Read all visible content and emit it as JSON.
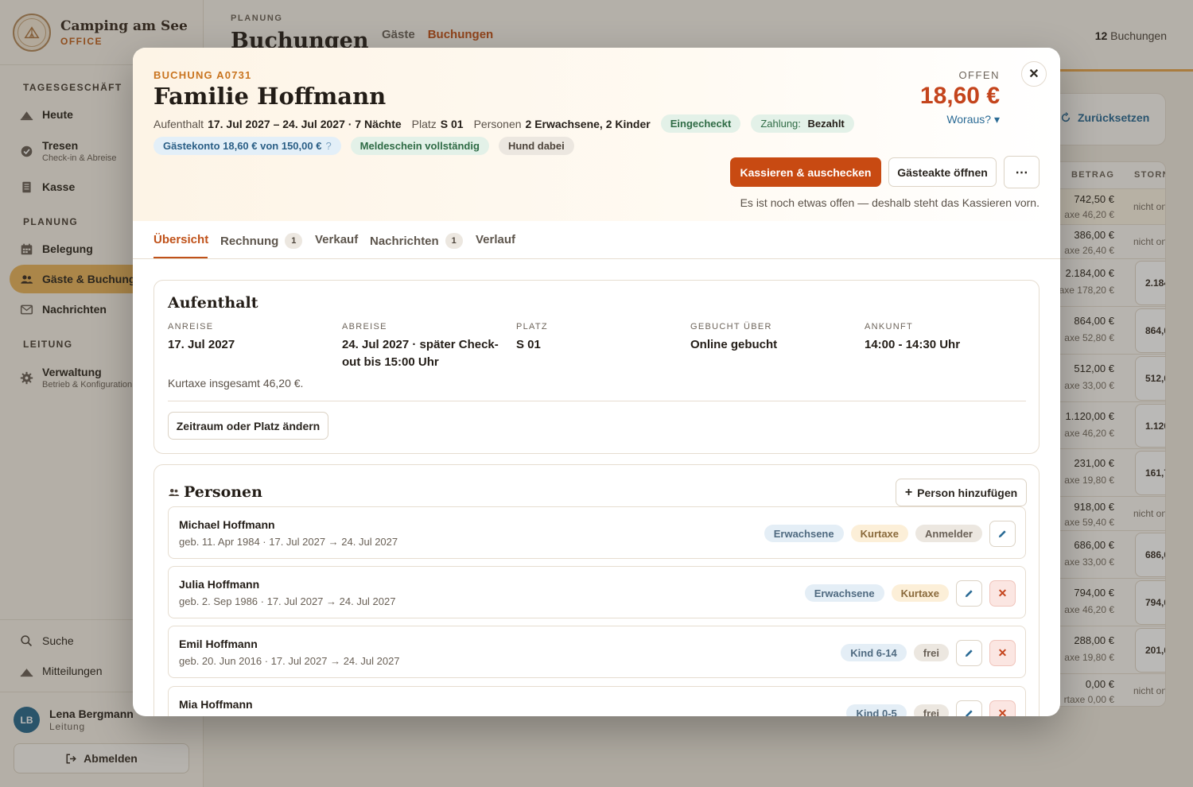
{
  "brand": {
    "name": "Camping am See",
    "sub": "OFFICE"
  },
  "nav": {
    "sections": [
      "TAGESGESCHÄFT",
      "PLANUNG",
      "LEITUNG"
    ],
    "items": [
      {
        "label": "Heute",
        "icon": "tent-icon"
      },
      {
        "label": "Tresen",
        "sub": "Check-in & Abreise",
        "icon": "check-circle-icon"
      },
      {
        "label": "Kasse",
        "icon": "receipt-icon"
      },
      {
        "label": "Belegung",
        "icon": "calendar-icon"
      },
      {
        "label": "Gäste & Buchungen",
        "icon": "users-icon",
        "active": true
      },
      {
        "label": "Nachrichten",
        "icon": "mail-icon"
      },
      {
        "label": "Verwaltung",
        "sub": "Betrieb & Konfiguration",
        "icon": "gear-icon"
      }
    ],
    "search": "Suche",
    "notifications": "Mitteilungen"
  },
  "user": {
    "initials": "LB",
    "name": "Lena Bergmann",
    "role": "Leitung",
    "logout": "Abmelden"
  },
  "header": {
    "eyebrow": "PLANUNG",
    "title": "Buchungen",
    "tabs": [
      "Gäste",
      "Buchungen"
    ],
    "count_value": "12",
    "count_label": "Buchungen"
  },
  "table": {
    "reset": "Zurücksetzen",
    "headers": [
      "BETRAG",
      "STORNO"
    ],
    "rows": [
      {
        "amount": "742,50 €",
        "tax": "axe 46,20 €",
        "storno": "nicht on"
      },
      {
        "amount": "386,00 €",
        "tax": "axe 26,40 €",
        "storno": "nicht on"
      },
      {
        "amount": "2.184,00 €",
        "tax": "axe 178,20 €",
        "storno_box": "2.184"
      },
      {
        "amount": "864,00 €",
        "tax": "axe 52,80 €",
        "storno_box": "864,0"
      },
      {
        "amount": "512,00 €",
        "tax": "axe 33,00 €",
        "storno_box": "512,0"
      },
      {
        "amount": "1.120,00 €",
        "tax": "axe 46,20 €",
        "storno_box": "1.120"
      },
      {
        "amount": "231,00 €",
        "tax": "axe 19,80 €",
        "storno_box": "161,7"
      },
      {
        "amount": "918,00 €",
        "tax": "axe 59,40 €",
        "storno": "nicht on"
      },
      {
        "amount": "686,00 €",
        "tax": "axe 33,00 €",
        "storno_box": "686,0"
      },
      {
        "amount": "794,00 €",
        "tax": "axe 46,20 €",
        "storno_box": "794,0"
      },
      {
        "amount": "288,00 €",
        "tax": "axe 19,80 €",
        "storno_box": "201,6"
      },
      {
        "amount": "0,00 €",
        "tax": "rtaxe 0,00 €",
        "storno": "nicht on"
      }
    ]
  },
  "modal": {
    "eyebrow": "BUCHUNG A0731",
    "title": "Familie Hoffmann",
    "meta": {
      "stay_label": "Aufenthalt",
      "stay_value": "17. Jul 2027 – 24. Jul 2027 · 7 Nächte",
      "pitch_label": "Platz",
      "pitch_value": "S 01",
      "persons_label": "Personen",
      "persons_value": "2 Erwachsene, 2 Kinder"
    },
    "pills": {
      "checked_in": "Eingecheckt",
      "payment_label": "Zahlung:",
      "payment_value": "Bezahlt",
      "account": "Gästekonto 18,60 € von 150,00 €",
      "account_help": "?",
      "registration": "Meldeschein vollständig",
      "dog": "Hund dabei"
    },
    "status": {
      "label": "OFFEN",
      "amount": "18,60 €",
      "link": "Woraus? ▾"
    },
    "close": "✕",
    "actions": {
      "primary": "Kassieren & auschecken",
      "secondary": "Gästeakte öffnen",
      "more": "⋯"
    },
    "hint": "Es ist noch etwas offen — deshalb steht das Kassieren vorn.",
    "tabs": [
      {
        "label": "Übersicht"
      },
      {
        "label": "Rechnung",
        "badge": "1"
      },
      {
        "label": "Verkauf"
      },
      {
        "label": "Nachrichten",
        "badge": "1"
      },
      {
        "label": "Verlauf"
      }
    ],
    "stay": {
      "title": "Aufenthalt",
      "fields": [
        {
          "label": "ANREISE",
          "value": "17. Jul 2027"
        },
        {
          "label": "ABREISE",
          "value": "24. Jul 2027 · später Check-out bis 15:00 Uhr"
        },
        {
          "label": "PLATZ",
          "value": "S 01"
        },
        {
          "label": "GEBUCHT ÜBER",
          "value": "Online gebucht"
        },
        {
          "label": "ANKUNFT",
          "value": "14:00 - 14:30 Uhr"
        }
      ],
      "note": "Kurtaxe insgesamt 46,20 €.",
      "change_button": "Zeitraum oder Platz ändern"
    },
    "persons": {
      "title": "Personen",
      "add_button": "Person hinzufügen",
      "add_plus": "+",
      "list": [
        {
          "name": "Michael Hoffmann",
          "detail": "geb. 11. Apr 1984 · 17. Jul 2027 → 24. Jul 2027",
          "tags": [
            "Erwachsene",
            "Kurtaxe",
            "Anmelder"
          ]
        },
        {
          "name": "Julia Hoffmann",
          "detail": "geb. 2. Sep 1986 · 17. Jul 2027 → 24. Jul 2027",
          "tags": [
            "Erwachsene",
            "Kurtaxe"
          ]
        },
        {
          "name": "Emil Hoffmann",
          "detail": "geb. 20. Jun 2016 · 17. Jul 2027 → 24. Jul 2027",
          "tags": [
            "Kind 6-14",
            "frei"
          ]
        },
        {
          "name": "Mia Hoffmann",
          "detail": "",
          "tags": [
            "Kind 0-5",
            "frei"
          ]
        }
      ],
      "remove": "✕"
    }
  }
}
